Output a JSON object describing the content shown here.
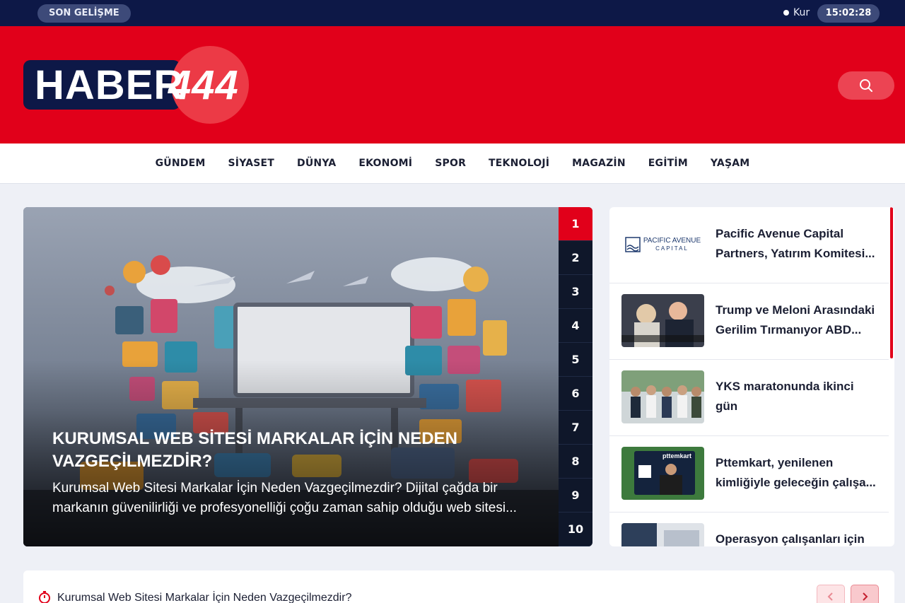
{
  "topbar": {
    "breaking_label": "SON GELİŞME",
    "rate_label": "Kur",
    "clock": "15:02:28"
  },
  "logo": {
    "word": "HABER",
    "number": "444"
  },
  "nav": {
    "items": [
      "GÜNDEM",
      "SİYASET",
      "DÜNYA",
      "EKONOMİ",
      "SPOR",
      "TEKNOLOJİ",
      "MAGAZİN",
      "EGİTİM",
      "YAŞAM"
    ]
  },
  "slider": {
    "title": "KURUMSAL WEB SİTESİ MARKALAR İÇİN NEDEN VAZGEÇİLMEZDİR?",
    "description": "Kurumsal Web Sitesi Markalar İçin Neden Vazgeçilmezdir? Dijital çağda bir markanın güvenilirliği ve profesyonelliği çoğu zaman sahip olduğu web sitesi...",
    "pages": [
      "1",
      "2",
      "3",
      "4",
      "5",
      "6",
      "7",
      "8",
      "9",
      "10"
    ],
    "active_page": "1"
  },
  "side": {
    "items": [
      {
        "title": "Pacific Avenue Capital Partners, Yatırım Komitesi...",
        "thumb_text": "PACIFIC AVENUE",
        "thumb_sub": "CAPITAL"
      },
      {
        "title": "Trump ve Meloni Arasındaki Gerilim Tırmanıyor ABD..."
      },
      {
        "title": "YKS maratonunda ikinci gün"
      },
      {
        "title": "Pttemkart, yenilenen kimliğiyle geleceğin çalışa...",
        "thumb_text": "pttemkart"
      },
      {
        "title": "Operasyon çalışanları için"
      }
    ]
  },
  "ticker": {
    "text": "Kurumsal Web Sitesi Markalar İçin Neden Vazgeçilmezdir?"
  },
  "colors": {
    "brand_red": "#e1001a",
    "navy": "#0d1847"
  }
}
